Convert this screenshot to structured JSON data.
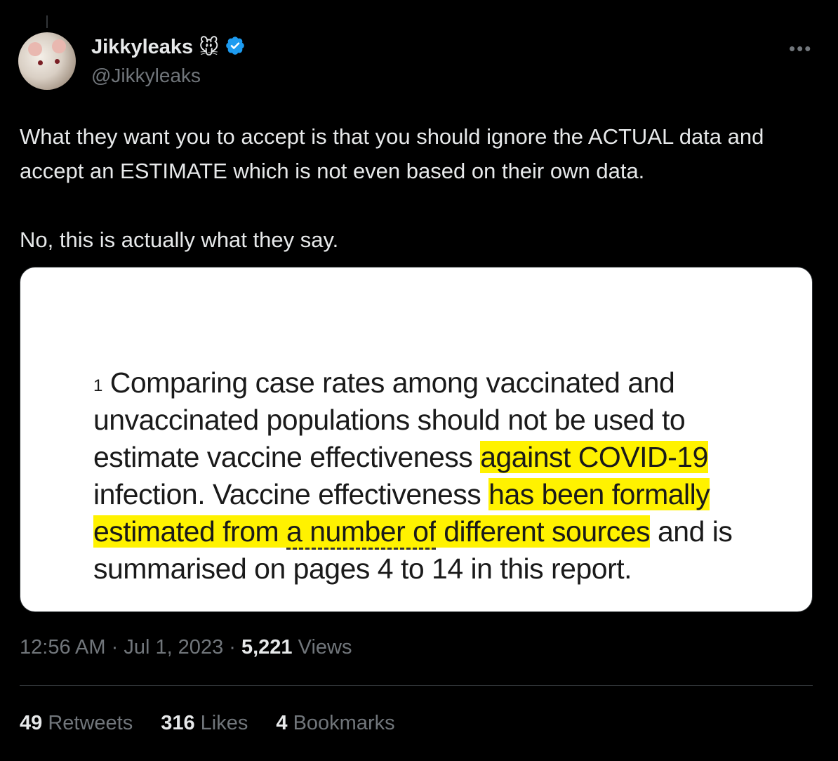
{
  "author": {
    "display_name": "Jikkyleaks",
    "emoji": "🐭",
    "handle": "@Jikkyleaks",
    "verified": true,
    "verified_color": "#1d9bf0"
  },
  "menu": {
    "more_icon": "•••"
  },
  "tweet": {
    "paragraph1": "What they want you to accept is that you should ignore the ACTUAL data and accept an ESTIMATE which is not even based on their own data.",
    "paragraph2": "No, this is actually what they say."
  },
  "image": {
    "footnote_mark": "1",
    "seg1": " Comparing case rates among vaccinated and unvaccinated populations should not be used to estimate vaccine effectiveness ",
    "seg2": "against COVID-19",
    "seg3": " infection. Vaccine effectiveness ",
    "seg4": "has been formally estimated from ",
    "seg5": "a number of",
    "seg6": " different sources",
    "seg7": " and is summarised on pages 4 to 14 in this report.",
    "highlight_color": "#fff200"
  },
  "meta": {
    "time": "12:56 AM",
    "sep1": " · ",
    "date": "Jul 1, 2023",
    "sep2": " · ",
    "views_count": "5,221",
    "views_label": " Views"
  },
  "stats": {
    "retweets_count": "49",
    "retweets_label": " Retweets",
    "likes_count": "316",
    "likes_label": " Likes",
    "bookmarks_count": "4",
    "bookmarks_label": " Bookmarks"
  }
}
